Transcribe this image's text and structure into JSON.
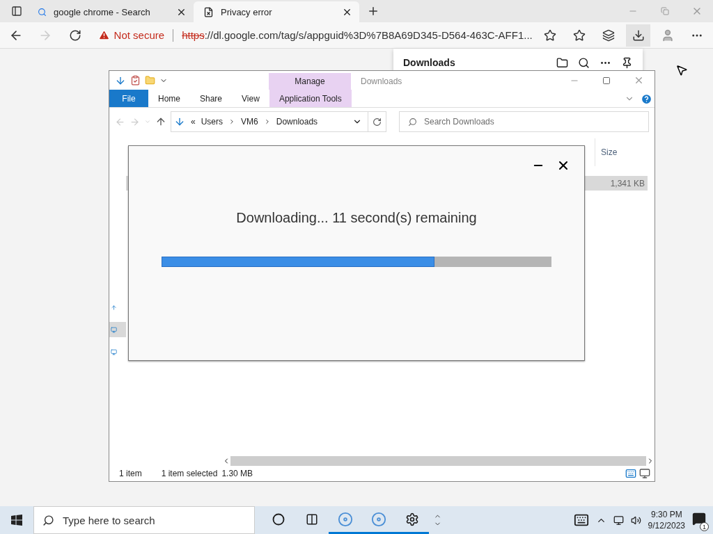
{
  "browser": {
    "tabs": [
      {
        "label": "google chrome - Search",
        "selected": false,
        "kind": "search"
      },
      {
        "label": "Privacy error",
        "selected": true,
        "kind": "error"
      }
    ],
    "address": {
      "warning": "Not secure",
      "scheme": "https",
      "rest": "://dl.google.com/tag/s/appguid%3D%7B8A69D345-D564-463C-AFF1..."
    },
    "downloads_panel": {
      "title": "Downloads"
    }
  },
  "explorer": {
    "context_tab": "Manage",
    "title": "Downloads",
    "ribbon_tabs": [
      {
        "label": "File",
        "kind": "file",
        "selected": false
      },
      {
        "label": "Home",
        "kind": "tab",
        "selected": false
      },
      {
        "label": "Share",
        "kind": "tab",
        "selected": false
      },
      {
        "label": "View",
        "kind": "tab",
        "selected": false
      },
      {
        "label": "Application Tools",
        "kind": "context",
        "selected": false
      }
    ],
    "path_prefix": "«",
    "path": [
      "Users",
      "VM6",
      "Downloads"
    ],
    "search": {
      "placeholder": "Search Downloads"
    },
    "columns": [
      "Size"
    ],
    "rows": [
      {
        "size": "1,341 KB",
        "selected": true
      }
    ],
    "status": [
      "1 item",
      "1 item selected",
      "1.30 MB"
    ]
  },
  "dialog": {
    "message": "Downloading... 11 second(s) remaining",
    "progress": {
      "level": 0.7
    }
  },
  "taskbar": {
    "search": {
      "placeholder": "Type here to search"
    },
    "apps": [
      {
        "kind": "cortana",
        "running": false
      },
      {
        "kind": "taskview",
        "running": false
      },
      {
        "kind": "disc",
        "running": true
      },
      {
        "kind": "disc",
        "running": true
      },
      {
        "kind": "settings",
        "running": true
      }
    ],
    "time": "9:30 PM",
    "date": "9/12/2023",
    "notifications": "1"
  }
}
